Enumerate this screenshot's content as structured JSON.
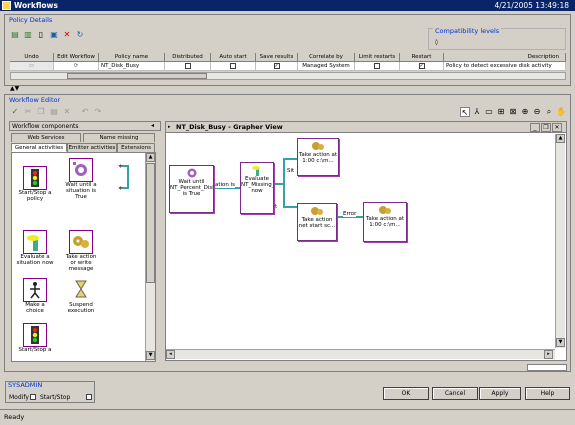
{
  "window": {
    "title": "Workflows",
    "datetime": "4/21/2005 13:49:18"
  },
  "policy_details": {
    "label": "Policy Details",
    "compat_label": "Compatibility levels",
    "columns": [
      "Undo",
      "Edit Workflow",
      "Policy name",
      "Distributed",
      "Auto start",
      "Save results",
      "Correlate by",
      "Limit restarts",
      "Restart",
      "Description"
    ],
    "row": {
      "policy_name": "NT_Disk_Busy",
      "correlate_by": "Managed System",
      "description": "Policy to detect excessive disk activity",
      "save_results_check": "✓",
      "restart_check": "✓"
    }
  },
  "editor": {
    "label": "Workflow Editor",
    "components_label": "Workflow components",
    "tabs_row1": [
      "Web Services",
      "Name missing"
    ],
    "tabs_row2": [
      "General activities",
      "Emitter activities",
      "Extensions"
    ],
    "palette": [
      {
        "label": "Start/Stop a policy",
        "icon": "traffic-light-icon"
      },
      {
        "label": "Wait until a situation is True",
        "icon": "wait-icon"
      },
      {
        "label": "Evaluate a situation now",
        "icon": "evaluate-icon"
      },
      {
        "label": "Take action or write message",
        "icon": "action-gear-icon"
      },
      {
        "label": "Make a choice",
        "icon": "choice-icon"
      },
      {
        "label": "Suspend execution",
        "icon": "hourglass-icon"
      },
      {
        "label": "Start/Stop a situation",
        "icon": "traffic-light-icon"
      }
    ],
    "grapher_title": "NT_Disk_Busy - Grapher View",
    "nodes": [
      {
        "label": "Wait until NT_Percent_Disk_Time is True"
      },
      {
        "label": "Evaluate NT_Missing_Process now"
      },
      {
        "label": "Take action at 1:00 c:\\m..."
      },
      {
        "label": "Take action net start sc..."
      },
      {
        "label": "Take action at 1:00 c:\\m..."
      }
    ],
    "edge_labels": [
      "ation is",
      "Sit",
      "Sit",
      "Error"
    ]
  },
  "footer": {
    "group_label": "SYSADMIN",
    "modify_label": "Modify",
    "startstop_label": "Start/Stop",
    "buttons": {
      "ok": "OK",
      "cancel": "Cancel",
      "apply": "Apply",
      "help": "Help"
    },
    "status": "Ready"
  }
}
